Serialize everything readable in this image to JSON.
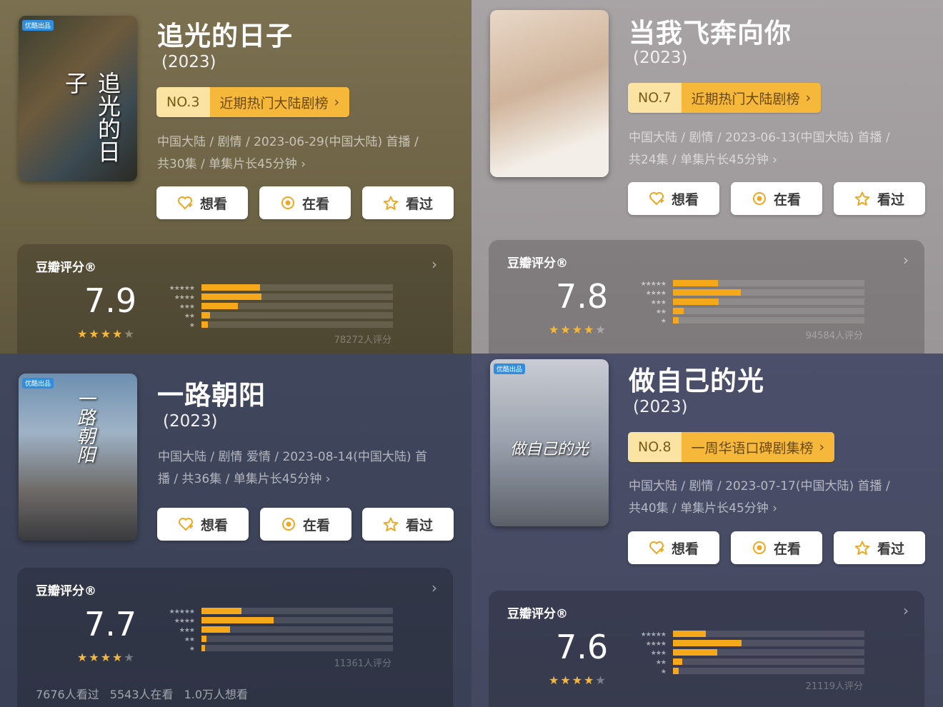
{
  "buttons": {
    "want": "想看",
    "watching": "在看",
    "watched": "看过"
  },
  "rating_title": "豆瓣评分®",
  "star_labels": [
    "★★★★★",
    "★★★★",
    "★★★",
    "★★",
    "★"
  ],
  "shows": [
    {
      "title": "追光的日子",
      "year": "(2023)",
      "poster_badge": "优酷出品",
      "poster_text": "追光的日子",
      "rank_no": "NO.3",
      "rank_label": "近期热门大陆剧榜",
      "meta_line1": "中国大陆 / 剧情 / 2023-06-29(中国大陆) 首播 /",
      "meta_line2": "共30集 / 单集片长45分钟 ›",
      "score": "7.9",
      "stars_full": 4,
      "distribution_percent": [
        30.5,
        31.5,
        19.0,
        4.5,
        3.5
      ],
      "rating_count": "78272人评分",
      "colors": {
        "accent": "#f6b83b",
        "bar": "#f6a81b"
      }
    },
    {
      "title": "当我飞奔向你",
      "year": "(2023)",
      "poster_badge": "",
      "poster_text": "",
      "rank_no": "NO.7",
      "rank_label": "近期热门大陆剧榜",
      "meta_line1": "中国大陆 / 剧情 / 2023-06-13(中国大陆) 首播 /",
      "meta_line2": "共24集 / 单集片长45分钟 ›",
      "score": "7.8",
      "stars_full": 4,
      "distribution_percent": [
        23.5,
        35.5,
        24.0,
        5.5,
        3.0
      ],
      "rating_count": "94584人评分",
      "colors": {
        "accent": "#f6b83b",
        "bar": "#f6a81b"
      }
    },
    {
      "title": "一路朝阳",
      "year": "(2023)",
      "poster_badge": "优酷出品",
      "poster_text": "一路朝阳",
      "rank_no": "",
      "rank_label": "",
      "meta_line1": "中国大陆 / 剧情 爱情 / 2023-08-14(中国大陆) 首",
      "meta_line2": "播 / 共36集 / 单集片长45分钟 ›",
      "score": "7.7",
      "stars_full": 4,
      "distribution_percent": [
        21.0,
        37.5,
        15.0,
        2.5,
        2.0
      ],
      "rating_count": "11361人评分",
      "stats": "7676人看过 5543人在看 1.0万人想看",
      "colors": {
        "accent": "#f6b83b",
        "bar": "#f6a81b"
      }
    },
    {
      "title": "做自己的光",
      "year": "(2023)",
      "poster_badge": "优酷出品",
      "poster_text": "做自己的光",
      "rank_no": "NO.8",
      "rank_label": "一周华语口碑剧集榜",
      "meta_line1": "中国大陆 / 剧情 / 2023-07-17(中国大陆) 首播 /",
      "meta_line2": "共40集 / 单集片长45分钟 ›",
      "score": "7.6",
      "stars_full": 4,
      "distribution_percent": [
        17.0,
        36.0,
        23.0,
        5.0,
        3.0
      ],
      "rating_count": "21119人评分",
      "colors": {
        "accent": "#f6b83b",
        "bar": "#f6a81b"
      }
    }
  ]
}
